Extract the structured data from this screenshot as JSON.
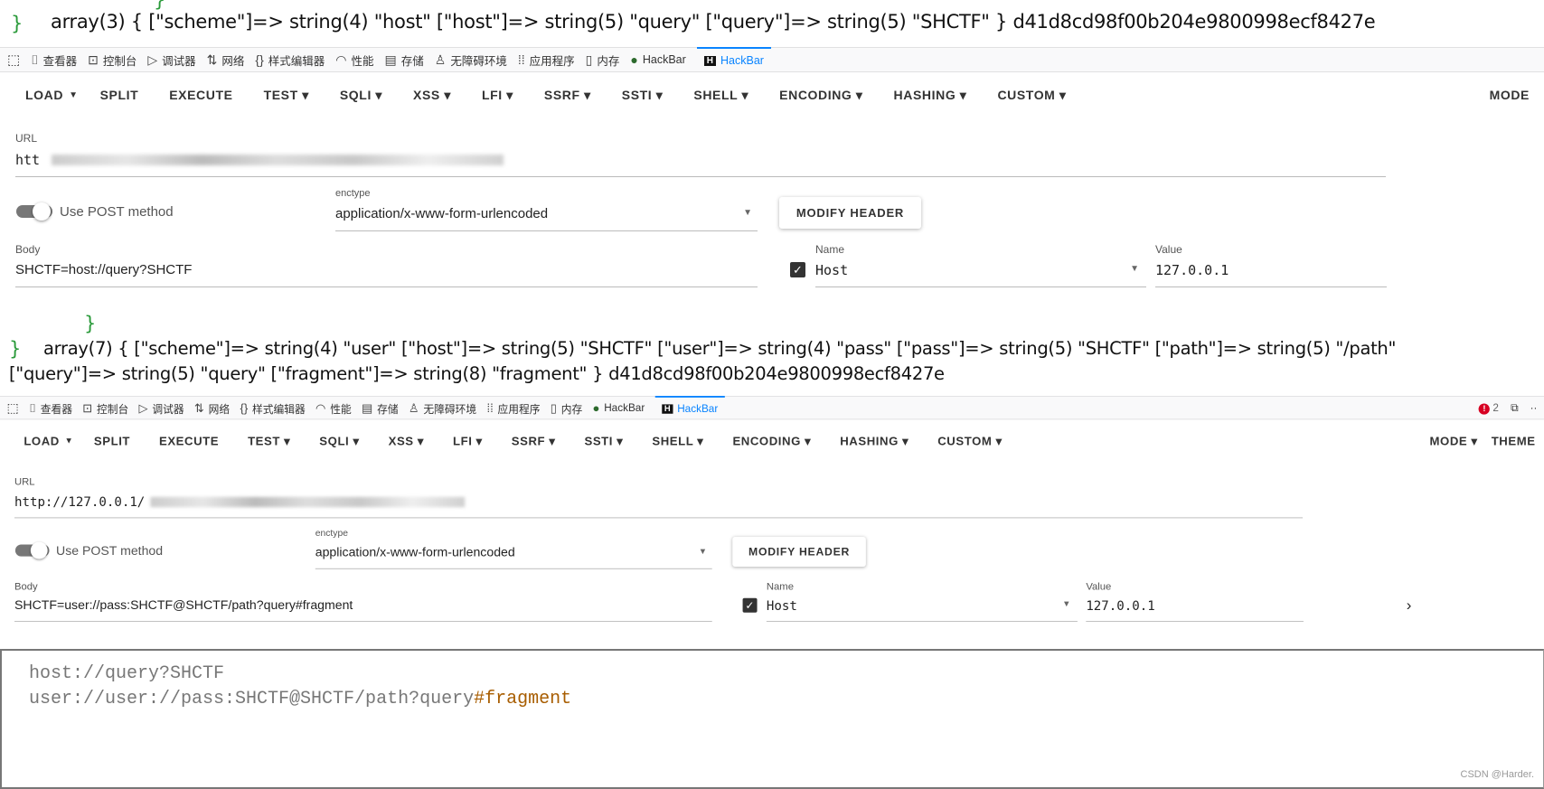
{
  "output1": {
    "brace_top": "}",
    "brace": "}",
    "text": "array(3) { [\"scheme\"]=> string(4) \"host\" [\"host\"]=> string(5) \"query\" [\"query\"]=> string(5) \"SHCTF\" } d41d8cd98f00b204e9800998ecf8427e"
  },
  "output2": {
    "brace_top": "}",
    "brace": "}",
    "line1": "array(7) { [\"scheme\"]=> string(4) \"user\" [\"host\"]=> string(5) \"SHCTF\" [\"user\"]=> string(4) \"pass\" [\"pass\"]=> string(5) \"SHCTF\" [\"path\"]=> string(5) \"/path\"",
    "line2": "[\"query\"]=> string(5) \"query\" [\"fragment\"]=> string(8) \"fragment\" } d41d8cd98f00b204e9800998ecf8427e"
  },
  "devtools": {
    "tabs": [
      {
        "label": "查看器",
        "icon": "inspector-icon",
        "glyph": "⌷"
      },
      {
        "label": "控制台",
        "icon": "console-icon",
        "glyph": "⊡"
      },
      {
        "label": "调试器",
        "icon": "debugger-icon",
        "glyph": "▷"
      },
      {
        "label": "网络",
        "icon": "network-icon",
        "glyph": "⇅"
      },
      {
        "label": "样式编辑器",
        "icon": "style-editor-icon",
        "glyph": "{}"
      },
      {
        "label": "性能",
        "icon": "performance-icon",
        "glyph": "◠"
      },
      {
        "label": "存储",
        "icon": "storage-icon",
        "glyph": "▤"
      },
      {
        "label": "无障碍环境",
        "icon": "accessibility-icon",
        "glyph": "♙"
      },
      {
        "label": "应用程序",
        "icon": "application-icon",
        "glyph": "⁞⁞"
      },
      {
        "label": "内存",
        "icon": "memory-icon",
        "glyph": "▯"
      },
      {
        "label": "HackBar",
        "icon": "hackbar-green-icon",
        "glyph": "●"
      },
      {
        "label": "HackBar",
        "icon": "hackbar-icon",
        "glyph": "H",
        "active": true
      }
    ],
    "error_count": "2"
  },
  "hackbar1": {
    "menu": [
      "LOAD",
      "SPLIT",
      "EXECUTE",
      "TEST ▾",
      "SQLI ▾",
      "XSS ▾",
      "LFI ▾",
      "SSRF ▾",
      "SSTI ▾",
      "SHELL ▾",
      "ENCODING ▾",
      "HASHING ▾",
      "CUSTOM ▾"
    ],
    "menu_right": [
      "MODE"
    ],
    "url_label": "URL",
    "url_value": "htt",
    "post_label": "Use POST method",
    "post_enabled": true,
    "enctype_label": "enctype",
    "enctype_value": "application/x-www-form-urlencoded",
    "modify_header": "MODIFY HEADER",
    "body_label": "Body",
    "body_value": "SHCTF=host://query?SHCTF",
    "name_label": "Name",
    "name_value": "Host",
    "header_checked": true,
    "value_label": "Value",
    "value_value": "127.0.0.1"
  },
  "hackbar2": {
    "menu": [
      "LOAD",
      "SPLIT",
      "EXECUTE",
      "TEST ▾",
      "SQLI ▾",
      "XSS ▾",
      "LFI ▾",
      "SSRF ▾",
      "SSTI ▾",
      "SHELL ▾",
      "ENCODING ▾",
      "HASHING ▾",
      "CUSTOM ▾"
    ],
    "menu_right": [
      "MODE ▾",
      "THEME"
    ],
    "url_label": "URL",
    "url_value": "http://127.0.0.1/",
    "post_label": "Use POST method",
    "post_enabled": true,
    "enctype_label": "enctype",
    "enctype_value": "application/x-www-form-urlencoded",
    "modify_header": "MODIFY HEADER",
    "body_label": "Body",
    "body_value": "SHCTF=user://pass:SHCTF@SHCTF/path?query#fragment",
    "name_label": "Name",
    "name_value": "Host",
    "header_checked": true,
    "value_label": "Value",
    "value_value": "127.0.0.1"
  },
  "code": {
    "line1": "host://query?SHCTF",
    "line2_main": "user://user://pass:SHCTF@SHCTF/path?query",
    "line2_frag": "#fragment",
    "watermark": "CSDN @Harder."
  }
}
